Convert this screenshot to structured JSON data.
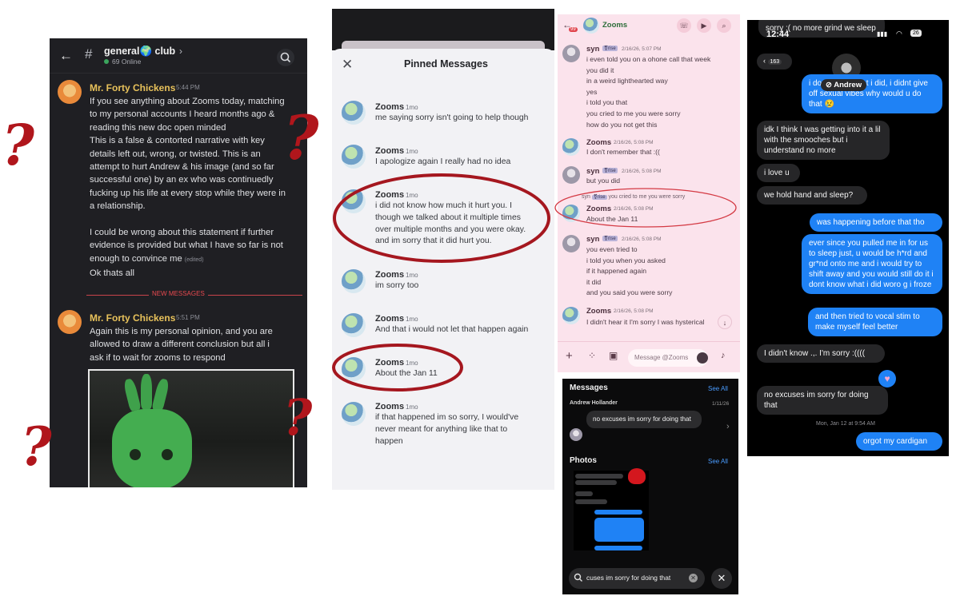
{
  "discord": {
    "channel": "general🌍 club",
    "online": "69 Online",
    "msg1": {
      "author": "Mr. Forty Chickens",
      "time": "5:44 PM",
      "lines": [
        "If you see anything about Zooms today, matching",
        "to my personal accounts I heard months ago &",
        "reading this new doc open minded",
        "This is a false & contorted narrative with key",
        "details left out, wrong, or twisted. This is an",
        "attempt to hurt Andrew & his image (and so far",
        "successful one) by an ex who was continuedly",
        "fucking up his life at every stop while they were in",
        "a relationship.",
        "",
        "I could be wrong about this statement if further",
        "evidence is provided but what I have so far is not",
        "enough to convince me"
      ],
      "edited": "(edited)",
      "last": "Ok thats all"
    },
    "new_messages": "NEW MESSAGES",
    "msg2": {
      "author": "Mr. Forty Chickens",
      "time": "5:51 PM",
      "lines": [
        "Again this is my personal opinion, and you are",
        "allowed to draw a different conclusion but all i",
        "ask if to wait for zooms to respond"
      ]
    }
  },
  "pinned": {
    "title": "Pinned Messages",
    "items": [
      {
        "author": "Zooms",
        "time": "1mo",
        "lines": [
          "me saying sorry isn't going to help though"
        ]
      },
      {
        "author": "Zooms",
        "time": "1mo",
        "lines": [
          "I apologize again I really had no idea"
        ]
      },
      {
        "author": "Zooms",
        "time": "1mo",
        "lines": [
          "i did not know how much it hurt you. I",
          "though we talked about it multiple times",
          "over multiple months and you were okay.",
          "and im sorry that it did hurt you."
        ]
      },
      {
        "author": "Zooms",
        "time": "1mo",
        "lines": [
          "im sorry too"
        ]
      },
      {
        "author": "Zooms",
        "time": "1mo",
        "lines": [
          "And that i would not let that happen again"
        ]
      },
      {
        "author": "Zooms",
        "time": "1mo",
        "lines": [
          "About the Jan 11"
        ]
      },
      {
        "author": "Zooms",
        "time": "1mo",
        "lines": [
          "if that happened im so sorry, I would've",
          "never meant for anything like that to",
          "happen"
        ]
      }
    ]
  },
  "pink": {
    "badge": "99",
    "contact": "Zooms",
    "composer_placeholder": "Message @Zooms",
    "groups": [
      {
        "author": "syn",
        "tag": "⚧rise",
        "time": "2/16/26, 5:07 PM",
        "lines": [
          "i even told you on a ohone call that week",
          "you did it",
          "in a weird lighthearted way",
          "yes",
          "i told you that",
          "you cried to me you were sorry",
          "how do you not get this"
        ]
      },
      {
        "author": "Zooms",
        "tag": "",
        "time": "2/16/26, 5:08 PM",
        "lines": [
          "I don't remember that :(("
        ]
      },
      {
        "author": "syn",
        "tag": "⚧rise",
        "time": "2/16/26, 5:08 PM",
        "lines": [
          "but you did"
        ]
      },
      {
        "author": "Zooms",
        "tag": "",
        "time": "2/16/26, 5:08 PM",
        "lines": [
          "About the Jan 11"
        ]
      },
      {
        "author": "syn",
        "tag": "⚧rise",
        "time": "2/16/26, 5:08 PM",
        "lines": [
          "you even tried to",
          "i told you when you asked",
          "if it happened again",
          "it did",
          "and you said you were sorry"
        ]
      },
      {
        "author": "Zooms",
        "tag": "",
        "time": "2/16/26, 5:08 PM",
        "lines": [
          "I didn't hear it I'm sorry I was hysterical"
        ]
      }
    ],
    "reply": {
      "author": "syn",
      "tag": "⚧rise",
      "text": "you cried to me you were sorry"
    }
  },
  "insta": {
    "messages_title": "Messages",
    "see_all_1": "See All",
    "contact": "Andrew Hollander",
    "date": "1/11/26",
    "message": "no excuses im sorry for doing that",
    "photos_title": "Photos",
    "see_all_2": "See All",
    "search_value": "cuses im sorry for doing that"
  },
  "imsg": {
    "clock": "12:44",
    "battery": "26",
    "back_count": "163",
    "contact": "Andrew",
    "top_grey": "sorry :( no more grind we sleep",
    "blue1": "i dont know what i did, i didnt give off sexual vibes why would u do that 😢",
    "grey1": "idk I think I was getting into it a lil with the smooches but i understand no more",
    "grey2": "i love u",
    "grey3": "we hold hand and sleep?",
    "blue2": "was happening before that tho",
    "blue3": "ever since you pulled me in for us to sleep just, u would be h*rd and gr*nd onto me and i would try to shift away and you would still do it i dont know what i did woro g i froze",
    "blue4": "and then tried to vocal stim to make myself feel better",
    "grey4": "I didn't know .,. I'm sorry :((((",
    "grey5": "no excuses im sorry for doing that",
    "timestamp": "Mon, Jan 12 at 9:54 AM",
    "blue5": "orgot my cardigan"
  },
  "annotations": {
    "symbol": "?"
  }
}
